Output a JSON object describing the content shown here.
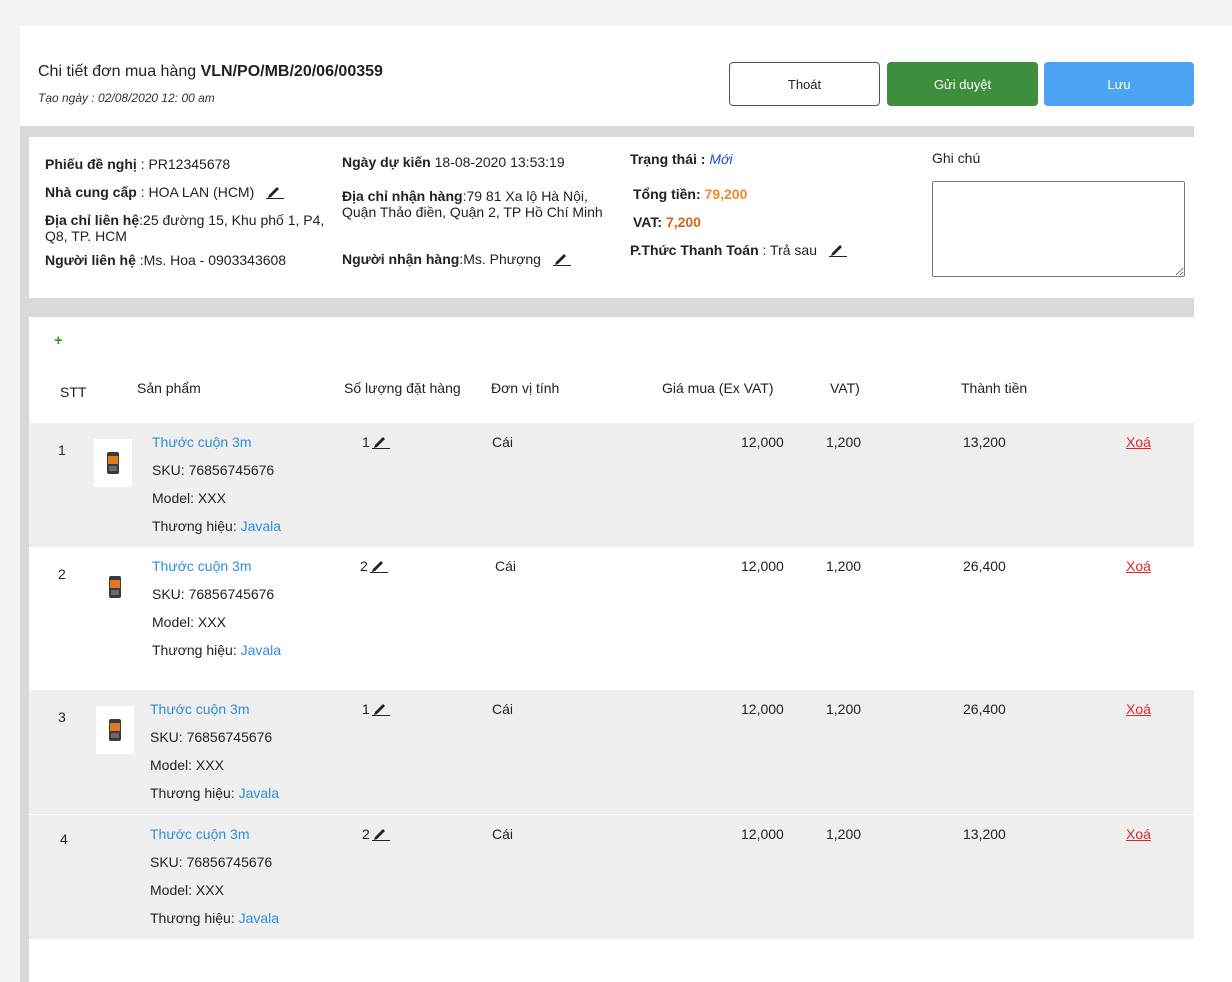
{
  "header": {
    "title_prefix": "Chi tiết đơn mua hàng",
    "po_code": "VLN/PO/MB/20/06/00359",
    "created": "Tạo ngày : 02/08/2020 12: 00 am"
  },
  "buttons": {
    "exit": "Thoát",
    "submit": "Gửi duyệt",
    "save": "Lưu"
  },
  "info": {
    "request_label": "Phiếu đề nghị",
    "request_value": " : PR12345678",
    "supplier_label": "Nhà cung cấp",
    "supplier_value": " : HOA LAN (HCM)",
    "contact_addr_label": "Địa chỉ liên hệ",
    "contact_addr_value": ":25 đường 15, Khu phố 1, P4, Q8, TP. HCM",
    "contact_person_label": "Người liên hệ",
    "contact_person_value": " :Ms. Hoa - 0903343608",
    "expected_date_label": "Ngày dự kiến",
    "expected_date_value": " 18-08-2020 13:53:19",
    "delivery_addr_label": "Địa chỉ nhận hàng",
    "delivery_addr_value": ":79 81 Xa lộ Hà Nội, Quận Thảo điền, Quận 2, TP Hồ Chí Minh",
    "receiver_label": "Người nhận hàng",
    "receiver_value": ":Ms. Phượng",
    "status_label": "Trạng thái :",
    "status_value": "Mới",
    "total_label": "Tổng tiền:",
    "total_value": "79,200",
    "vat_label": "VAT:",
    "vat_value": "7,200",
    "payment_label": "P.Thức Thanh Toán",
    "payment_value": " : Trả sau",
    "note_label": "Ghi chú",
    "note_value": ""
  },
  "table": {
    "add_symbol": "+",
    "headers": {
      "stt": "STT",
      "product": "Sản phẩm",
      "qty": "Số lượng đặt hàng",
      "unit": "Đơn vị tính",
      "price": "Giá mua (Ex VAT)",
      "vat": "VAT)",
      "total": "Thành tiền"
    },
    "rows": [
      {
        "stt": "1",
        "name": "Thước cuộn 3m",
        "sku": "SKU: 76856745676",
        "model": "Model: XXX",
        "brand_label": "Thương hiệu: ",
        "brand": "Javala",
        "qty": "1",
        "unit": "Cái",
        "price": "12,000",
        "vat": "1,200",
        "total": "13,200",
        "delete": "Xoá"
      },
      {
        "stt": "2",
        "name": "Thước cuộn 3m",
        "sku": "SKU: 76856745676",
        "model": "Model: XXX",
        "brand_label": "Thương hiệu: ",
        "brand": "Javala",
        "qty": "2",
        "unit": "Cái",
        "price": "12,000",
        "vat": "1,200",
        "total": "26,400",
        "delete": "Xoá"
      },
      {
        "stt": "3",
        "name": "Thước cuộn 3m",
        "sku": "SKU: 76856745676",
        "model": "Model: XXX",
        "brand_label": "Thương hiệu: ",
        "brand": "Javala",
        "qty": "1",
        "unit": "Cái",
        "price": "12,000",
        "vat": "1,200",
        "total": "26,400",
        "delete": "Xoá"
      },
      {
        "stt": "4",
        "name": "Thước cuộn 3m",
        "sku": "SKU: 76856745676",
        "model": "Model: XXX",
        "brand_label": "Thương hiệu: ",
        "brand": "Javala",
        "qty": "2",
        "unit": "Cái",
        "price": "12,000",
        "vat": "1,200",
        "total": "13,200",
        "delete": "Xoá"
      }
    ]
  },
  "icons": {
    "edit": "pencil-icon",
    "product_thumb": "tape-measure-icon",
    "add": "plus-icon"
  },
  "colors": {
    "submit": "#3d8f3d",
    "save": "#4aa3f5",
    "link": "#2e8de0",
    "delete": "#e0262b",
    "amount": "#f08a24"
  }
}
